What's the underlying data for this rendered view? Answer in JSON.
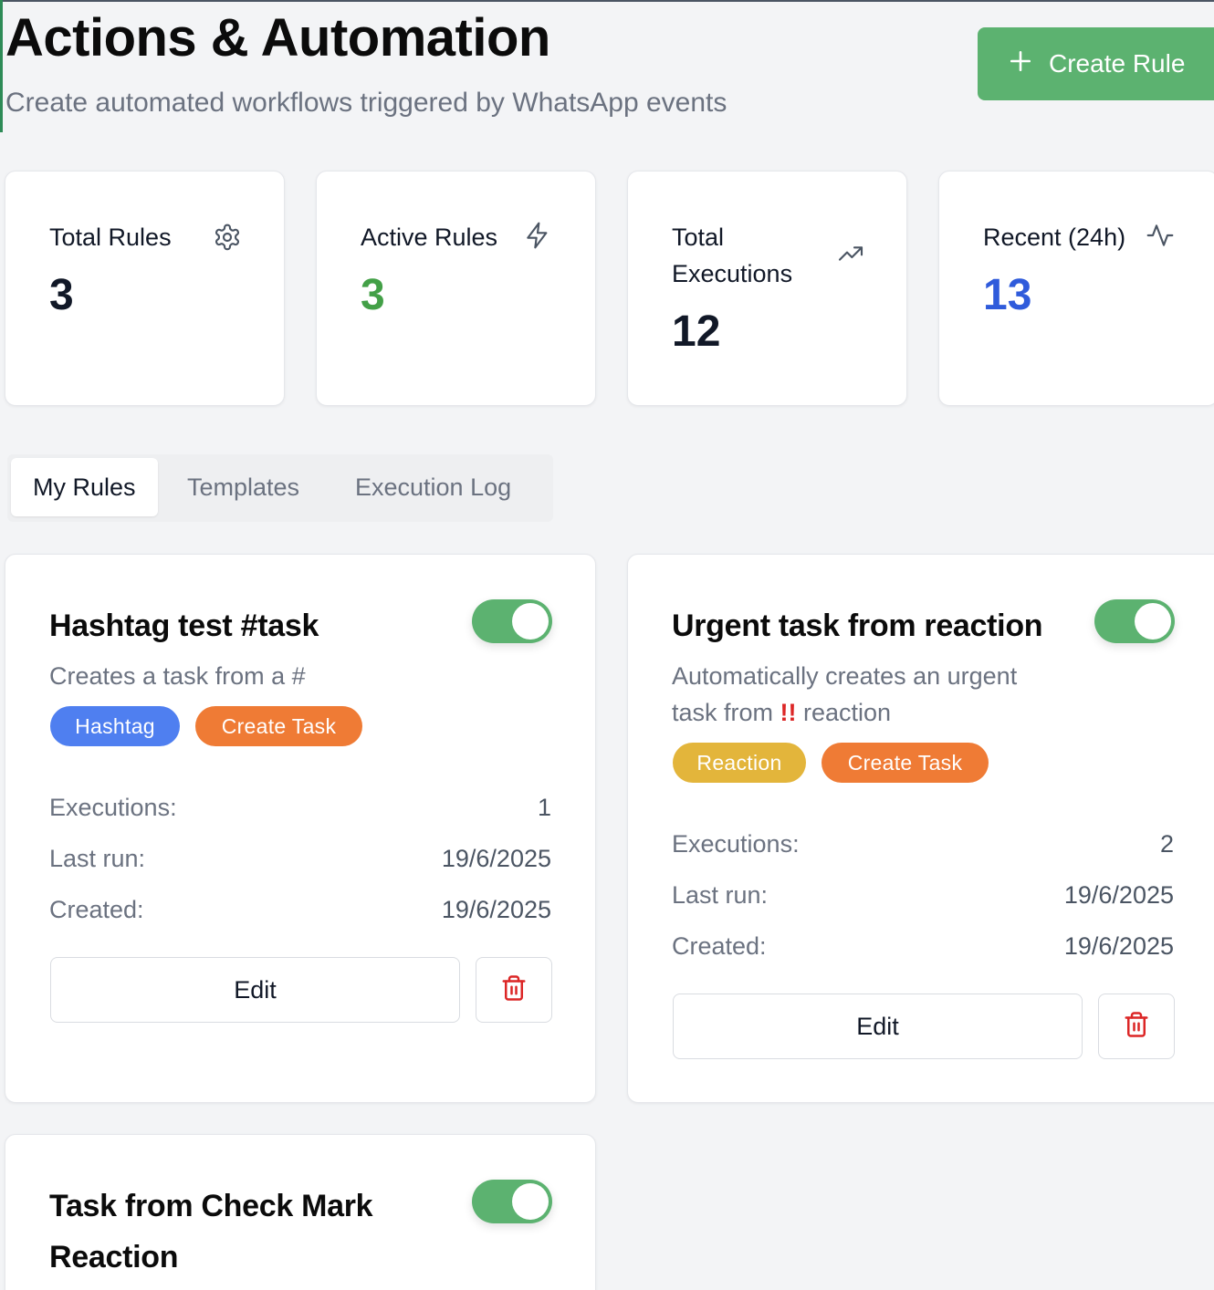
{
  "header": {
    "title": "Actions & Automation",
    "subtitle": "Create automated workflows triggered by WhatsApp events",
    "create_button": "Create Rule"
  },
  "stats": [
    {
      "label": "Total Rules",
      "value": "3",
      "icon": "gear-icon",
      "color": "#0b0b0b"
    },
    {
      "label": "Active Rules",
      "value": "3",
      "icon": "lightning-icon",
      "color": "#43a047"
    },
    {
      "label": "Total Executions",
      "value": "12",
      "icon": "trending-up-icon",
      "color": "#0b0b0b"
    },
    {
      "label": "Recent (24h)",
      "value": "13",
      "icon": "activity-icon",
      "color": "#2f5bdb"
    }
  ],
  "tabs": [
    "My Rules",
    "Templates",
    "Execution Log"
  ],
  "active_tab": "My Rules",
  "rules": [
    {
      "title": "Hashtag test #task",
      "description": "Creates a task from a #",
      "enabled": true,
      "badges": [
        {
          "label": "Hashtag",
          "color": "#4f7ff0"
        },
        {
          "label": "Create Task",
          "color": "#ef7b35"
        }
      ],
      "executions_label": "Executions:",
      "executions": "1",
      "last_run_label": "Last run:",
      "last_run": "19/6/2025",
      "created_label": "Created:",
      "created": "19/6/2025",
      "edit_label": "Edit"
    },
    {
      "title": "Urgent task from reaction",
      "description_line1": "Automatically creates an urgent",
      "description_pre": "task from ",
      "description_emoji": "!!",
      "description_post": " reaction",
      "enabled": true,
      "badges": [
        {
          "label": "Reaction",
          "color": "#e3b53b"
        },
        {
          "label": "Create Task",
          "color": "#ef7b35"
        }
      ],
      "executions_label": "Executions:",
      "executions": "2",
      "last_run_label": "Last run:",
      "last_run": "19/6/2025",
      "created_label": "Created:",
      "created": "19/6/2025",
      "edit_label": "Edit"
    },
    {
      "title_line1": "Task from Check Mark",
      "title_line2": "Reaction",
      "enabled": true
    }
  ]
}
